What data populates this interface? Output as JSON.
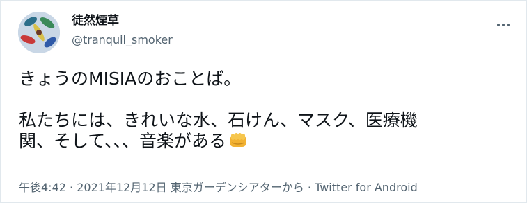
{
  "tweet": {
    "display_name": "徒然煙草",
    "handle": "@tranquil_smoker",
    "text_line1": "きょうのMISIAのおことば。",
    "text_line2": "私たちには、きれいな水、石けん、マスク、医療機",
    "text_line3": "関、そして、、、音楽がある",
    "emoji": "fist-emoji",
    "time": "午後4:42",
    "date": "2021年12月12日",
    "location": "東京ガーデンシアターから",
    "source": "Twitter for Android",
    "separator": "·"
  },
  "icons": {
    "more": "more-icon",
    "avatar": "avatar-image"
  }
}
